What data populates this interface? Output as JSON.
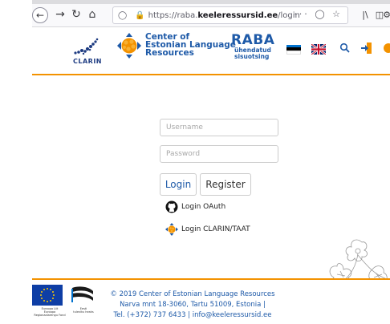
{
  "browser": {
    "url_prefix": "https://raba.",
    "url_domain": "keeleressursid.ee",
    "url_path": "/login",
    "icons": [
      "back-arrow-icon",
      "forward-arrow-icon",
      "reload-icon",
      "home-icon",
      "shield-icon",
      "lock-icon",
      "more-icon",
      "pocket-icon",
      "star-icon",
      "library-icon",
      "sidebar-icon",
      "extension-icon"
    ]
  },
  "header": {
    "clarin_label": "CLARIN",
    "cel_name_line1": "Center of",
    "cel_name_line2": "Estonian Language",
    "cel_name_line3": "Resources",
    "raba_title": "RABA",
    "raba_sub1": "ühendatud",
    "raba_sub2": "sisuotsing",
    "icons": [
      "estonian-flag-icon",
      "uk-flag-icon",
      "search-icon",
      "login-icon",
      "cel-icon"
    ]
  },
  "login": {
    "username_placeholder": "Username",
    "password_placeholder": "Password",
    "login_button": "Login",
    "register_button": "Register",
    "oauth_label": "Login OAuth",
    "clarin_label": "Login CLARIN/TAAT"
  },
  "footer": {
    "eu_caption_line1": "Euroopa Liit",
    "eu_caption_line2": "Euroopa",
    "eu_caption_line3": "Regionaalarengu Fond",
    "ee_caption_line1": "Eesti",
    "ee_caption_line2": "tuleviku heaks",
    "line1": "© 2019 Center of Estonian Language Resources",
    "line2": "Narva mnt 18-3060, Tartu 51009, Estonia |",
    "line3": "Tel. (+372) 737 6433 | info@keeleressursid.ee"
  },
  "colors": {
    "accent_orange": "#f39200",
    "brand_blue": "#1e5aa8"
  }
}
